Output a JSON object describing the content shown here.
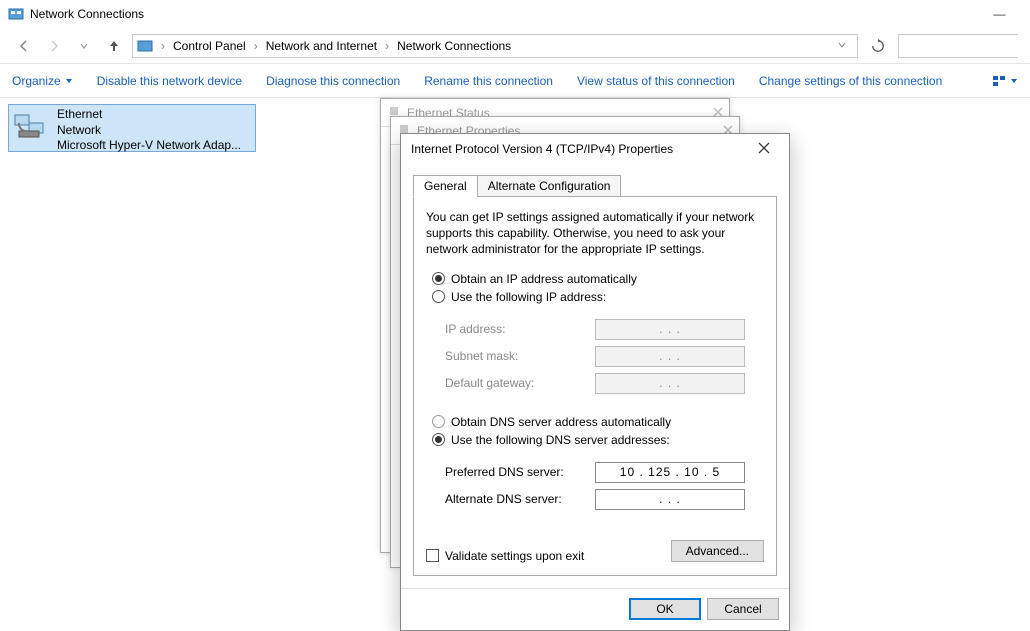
{
  "window": {
    "title": "Network Connections",
    "minimize": "—"
  },
  "breadcrumb": {
    "items": [
      "Control Panel",
      "Network and Internet",
      "Network Connections"
    ]
  },
  "commands": {
    "organize": "Organize",
    "disable": "Disable this network device",
    "diagnose": "Diagnose this connection",
    "rename": "Rename this connection",
    "view_status": "View status of this connection",
    "change_settings": "Change settings of this connection"
  },
  "adapter": {
    "name": "Ethernet",
    "status": "Network",
    "device": "Microsoft Hyper-V Network Adap..."
  },
  "bg_dialogs": {
    "status_title": "Ethernet Status",
    "props_title": "Ethernet Properties"
  },
  "dialog": {
    "title": "Internet Protocol Version 4 (TCP/IPv4) Properties",
    "tabs": {
      "general": "General",
      "alternate": "Alternate Configuration"
    },
    "description": "You can get IP settings assigned automatically if your network supports this capability. Otherwise, you need to ask your network administrator for the appropriate IP settings.",
    "obtain_ip": "Obtain an IP address automatically",
    "use_ip": "Use the following IP address:",
    "ip_address_label": "IP address:",
    "subnet_label": "Subnet mask:",
    "gateway_label": "Default gateway:",
    "ip_address_value": ".       .       .",
    "subnet_value": ".       .       .",
    "gateway_value": ".       .       .",
    "obtain_dns": "Obtain DNS server address automatically",
    "use_dns": "Use the following DNS server addresses:",
    "preferred_dns_label": "Preferred DNS server:",
    "alternate_dns_label": "Alternate DNS server:",
    "preferred_dns_value": "10 . 125 .  10  .   5",
    "alternate_dns_value": ".       .       .",
    "validate": "Validate settings upon exit",
    "advanced": "Advanced...",
    "ok": "OK",
    "cancel": "Cancel"
  }
}
